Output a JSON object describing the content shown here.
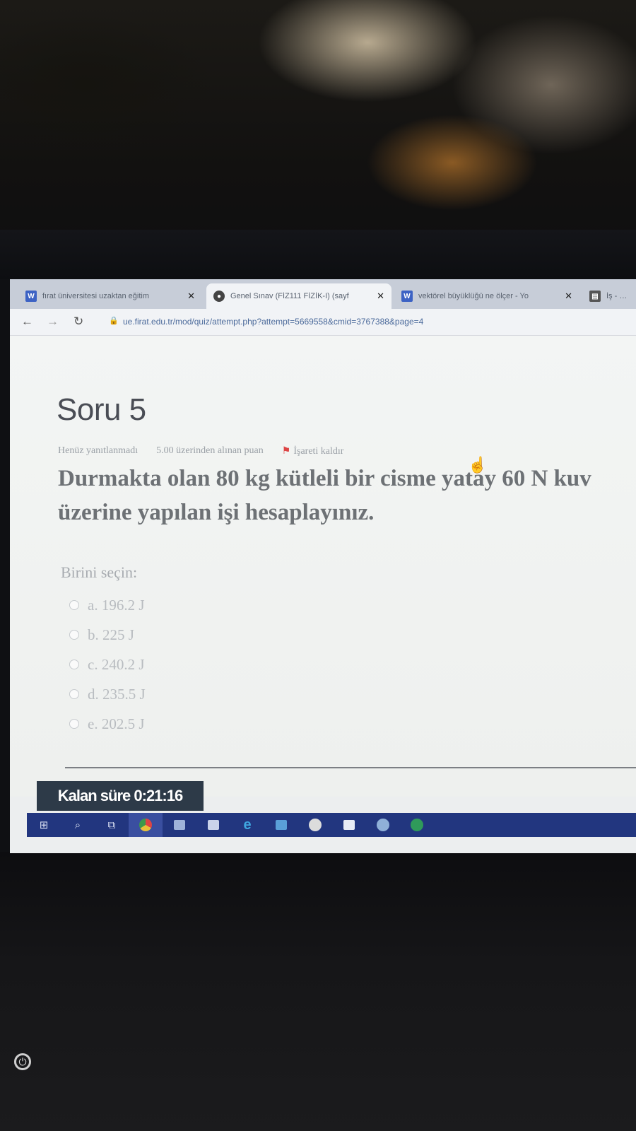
{
  "browser": {
    "tabs": [
      {
        "title": "fırat üniversitesi uzaktan eğitim",
        "favicon": "moodle-icon",
        "active": false
      },
      {
        "title": "Genel Sınav (FİZ111 FİZİK-I) (sayf",
        "favicon": "moodle-circle-icon",
        "active": true
      },
      {
        "title": "vektörel büyüklüğü ne ölçer - Yo",
        "favicon": "word-icon",
        "active": false
      },
      {
        "title": "İş - Gö",
        "favicon": "reader-icon",
        "active": false
      }
    ],
    "url": "ue.firat.edu.tr/mod/quiz/attempt.php?attempt=5669558&cmid=3767388&page=4"
  },
  "question": {
    "title": "Soru 5",
    "status": "Henüz yanıtlanmadı",
    "points": "5.00 üzerinden alınan puan",
    "flag_label": "İşareti kaldır",
    "text_line1": "Durmakta olan 80 kg kütleli bir cisme yatay 60 N kuv",
    "text_line2": "üzerine yapılan işi hesaplayınız.",
    "choose_label": "Birini seçin:",
    "options": [
      {
        "label": "a. 196.2 J",
        "selected": false
      },
      {
        "label": "b. 225 J",
        "selected": false
      },
      {
        "label": "c. 240.2 J",
        "selected": false
      },
      {
        "label": "d. 235.5 J",
        "selected": false
      },
      {
        "label": "e. 202.5 J",
        "selected": false
      }
    ]
  },
  "timer": {
    "label": "Kalan süre 0:21:16"
  },
  "taskbar": {
    "icons": [
      "windows-start-icon",
      "search-icon",
      "task-view-icon",
      "chrome-icon",
      "file-explorer-icon",
      "store-icon",
      "edge-icon",
      "mail-icon",
      "app-circle-icon",
      "app-hexagon-icon",
      "app-globe-icon",
      "app-green-icon"
    ]
  }
}
